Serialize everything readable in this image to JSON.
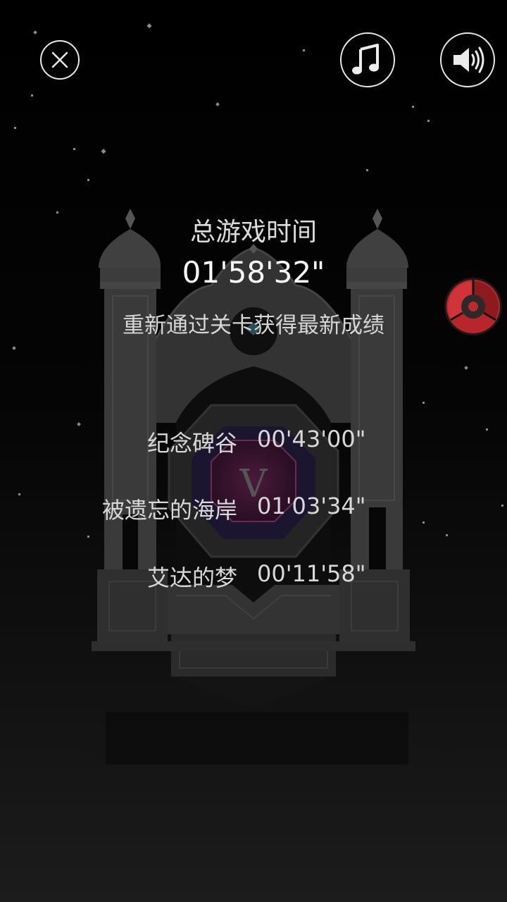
{
  "controls": {
    "close_icon": "close-icon",
    "music_icon": "music-note-icon",
    "sound_icon": "speaker-icon"
  },
  "summary": {
    "title": "总游戏时间",
    "total_time": "01'58'32\"",
    "hint": "重新通过关卡获得最新成绩"
  },
  "chapters": [
    {
      "name": "纪念碑谷",
      "time": "00'43'00\""
    },
    {
      "name": "被遗忘的海岸",
      "time": "01'03'34\""
    },
    {
      "name": "艾达的梦",
      "time": "00'11'58\""
    }
  ],
  "colors": {
    "accent_red": "#c0282d",
    "portal_purple": "#3a1430",
    "text": "#e6e6e6"
  }
}
